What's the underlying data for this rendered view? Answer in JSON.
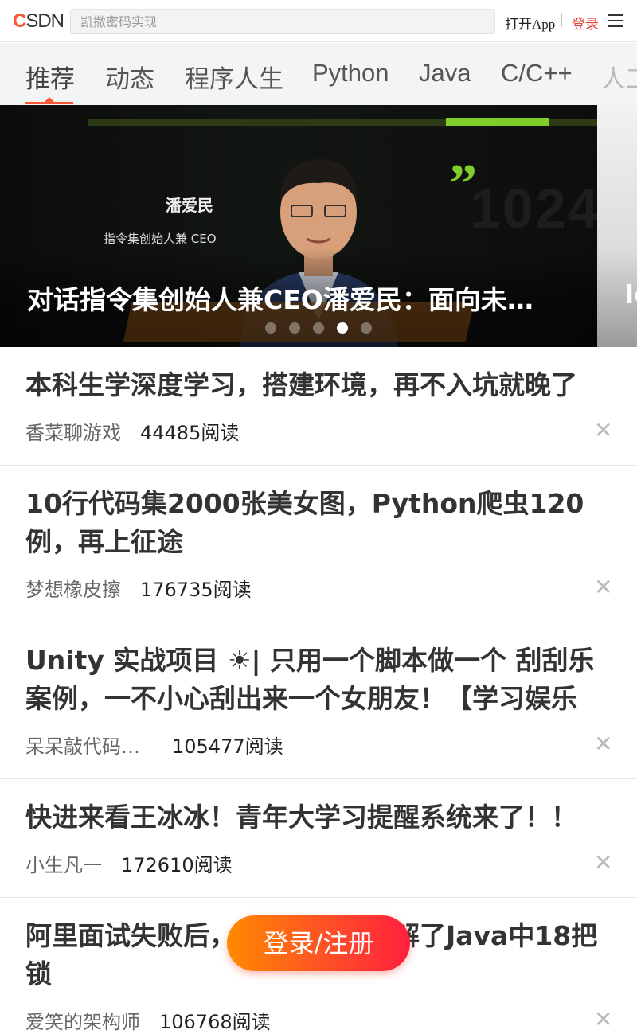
{
  "header": {
    "logo": "CSDN",
    "search_placeholder": "凯撒密码实现",
    "open_app": "打开App",
    "login": "登录"
  },
  "tabs": [
    {
      "label": "推荐",
      "active": true
    },
    {
      "label": "动态",
      "active": false
    },
    {
      "label": "程序人生",
      "active": false
    },
    {
      "label": "Python",
      "active": false
    },
    {
      "label": "Java",
      "active": false
    },
    {
      "label": "C/C++",
      "active": false
    },
    {
      "label": "人工",
      "active": false
    }
  ],
  "banner": {
    "title": "对话指令集创始人兼CEO潘爱民：面向未…",
    "person_name": "潘爱民",
    "person_role": "指令集创始人兼 CEO",
    "next_title": "Io",
    "total_slides": 5,
    "active_slide": 4
  },
  "feed": [
    {
      "title": "本科生学深度学习，搭建环境，再不入坑就晚了",
      "author": "香菜聊游戏",
      "reads": "44485阅读"
    },
    {
      "title": "10行代码集2000张美女图，Python爬虫120例，再上征途",
      "author": "梦想橡皮擦",
      "reads": "176735阅读"
    },
    {
      "title": "Unity 实战项目 ☀| 只用一个脚本做一个 刮刮乐 案例，一不小心刮出来一个女朋友！【学习娱乐",
      "author": "呆呆敲代码…",
      "reads": "105477阅读"
    },
    {
      "title": "快进来看王冰冰！青年大学习提醒系统来了！！",
      "author": "小生凡一",
      "reads": "172610阅读"
    },
    {
      "title": "阿里面试失败后，一气之下我图解了Java中18把锁",
      "author": "爱笑的架构师",
      "reads": "106768阅读"
    }
  ],
  "float_button": "登录/注册",
  "colors": {
    "accent": "#fc5531",
    "login": "#e33e33"
  }
}
